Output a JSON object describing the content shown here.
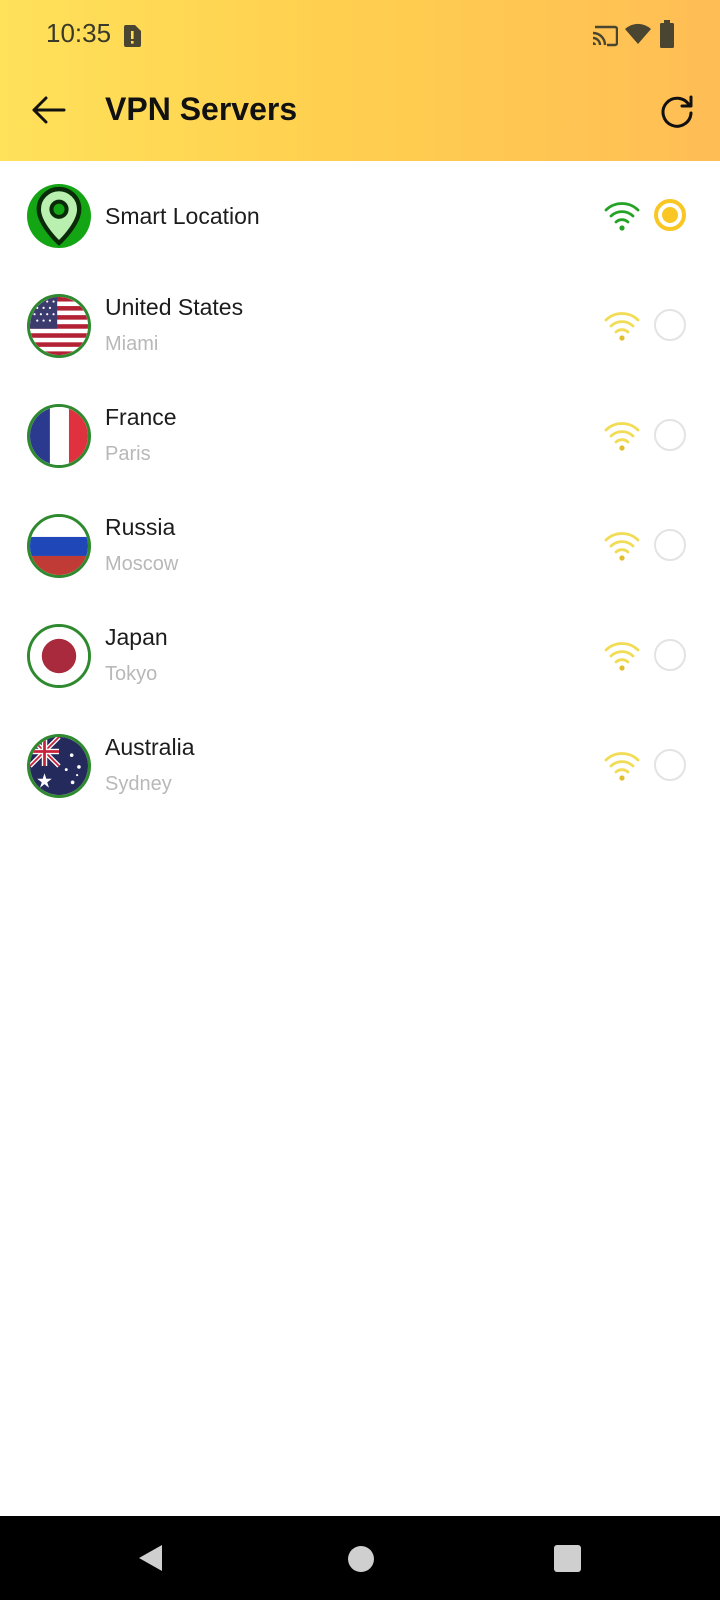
{
  "status_bar": {
    "time": "10:35",
    "icons": [
      "sim-alert-icon",
      "cast-icon",
      "wifi-icon",
      "battery-icon"
    ]
  },
  "header": {
    "title": "VPN Servers",
    "back_icon": "arrow-left-icon",
    "refresh_icon": "refresh-icon",
    "gradient_colors": [
      "#ffe15a",
      "#ffbd55"
    ]
  },
  "servers": [
    {
      "name": "Smart Location",
      "city": "",
      "icon": "location-pin-icon",
      "signal_color": "#26a326",
      "selected": true
    },
    {
      "name": "United States",
      "city": "Miami",
      "icon": "us-flag-icon",
      "signal_color": "#f2dc55",
      "selected": false
    },
    {
      "name": "France",
      "city": "Paris",
      "icon": "france-flag-icon",
      "signal_color": "#f2dc55",
      "selected": false
    },
    {
      "name": "Russia",
      "city": "Moscow",
      "icon": "russia-flag-icon",
      "signal_color": "#f2dc55",
      "selected": false
    },
    {
      "name": "Japan",
      "city": "Tokyo",
      "icon": "japan-flag-icon",
      "signal_color": "#f2dc55",
      "selected": false
    },
    {
      "name": "Australia",
      "city": "Sydney",
      "icon": "australia-flag-icon",
      "signal_color": "#f2dc55",
      "selected": false
    }
  ],
  "colors": {
    "accent": "#f9c623",
    "smart_location_green": "#14a514",
    "secondary_text": "#b8b8b8"
  },
  "nav_bar": {
    "icons": [
      "nav-back-icon",
      "nav-home-icon",
      "nav-recents-icon"
    ]
  }
}
